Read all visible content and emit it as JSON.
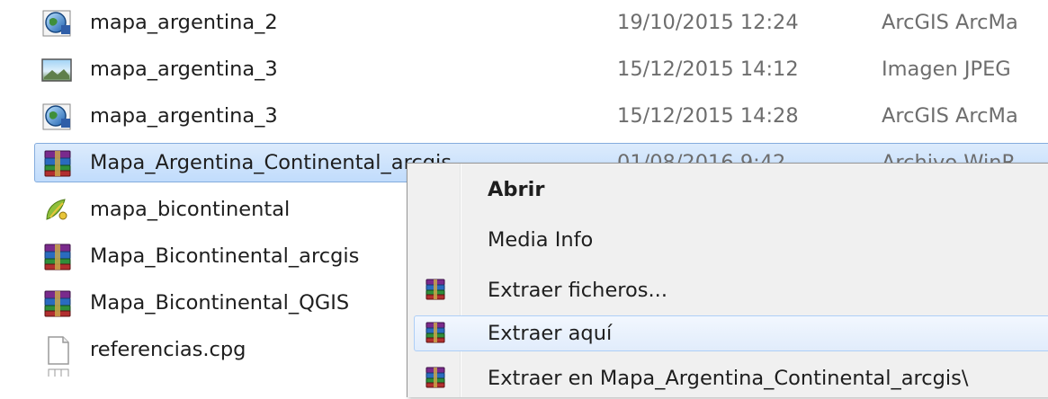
{
  "files": [
    {
      "name": "mapa_argentina_2",
      "date": "19/10/2015 12:24",
      "type": "ArcGIS ArcMa",
      "icon": "arcgis-globe-icon"
    },
    {
      "name": "mapa_argentina_3",
      "date": "15/12/2015 14:12",
      "type": "Imagen JPEG",
      "icon": "jpeg-image-icon"
    },
    {
      "name": "mapa_argentina_3",
      "date": "15/12/2015 14:28",
      "type": "ArcGIS ArcMa",
      "icon": "arcgis-globe-icon"
    },
    {
      "name": "Mapa_Argentina_Continental_arcgis",
      "date": "01/08/2016 9:42",
      "type": "Archivo WinR",
      "icon": "winrar-archive-icon",
      "selected": true
    },
    {
      "name": "mapa_bicontinental",
      "date": "",
      "type": "",
      "icon": "qgis-project-icon"
    },
    {
      "name": "Mapa_Bicontinental_arcgis",
      "date": "",
      "type": "",
      "icon": "winrar-archive-icon"
    },
    {
      "name": "Mapa_Bicontinental_QGIS",
      "date": "",
      "type": "",
      "icon": "winrar-archive-icon"
    },
    {
      "name": "referencias.cpg",
      "date": "",
      "type": "",
      "icon": "blank-file-icon"
    }
  ],
  "context_menu": {
    "items": [
      {
        "label": "Abrir",
        "bold": true,
        "icon": ""
      },
      {
        "label": "Media Info",
        "icon": ""
      },
      {
        "label": "Extraer ficheros...",
        "icon": "winrar-icon"
      },
      {
        "label": "Extraer aquí",
        "icon": "winrar-icon",
        "hover": true
      },
      {
        "label": "Extraer en Mapa_Argentina_Continental_arcgis\\",
        "icon": "winrar-icon"
      }
    ]
  },
  "colors": {
    "selection": "#cce8ff",
    "selection_border": "#84acdd",
    "menu_background": "#f0f0f0",
    "menu_hover": "#e1ecfb"
  }
}
